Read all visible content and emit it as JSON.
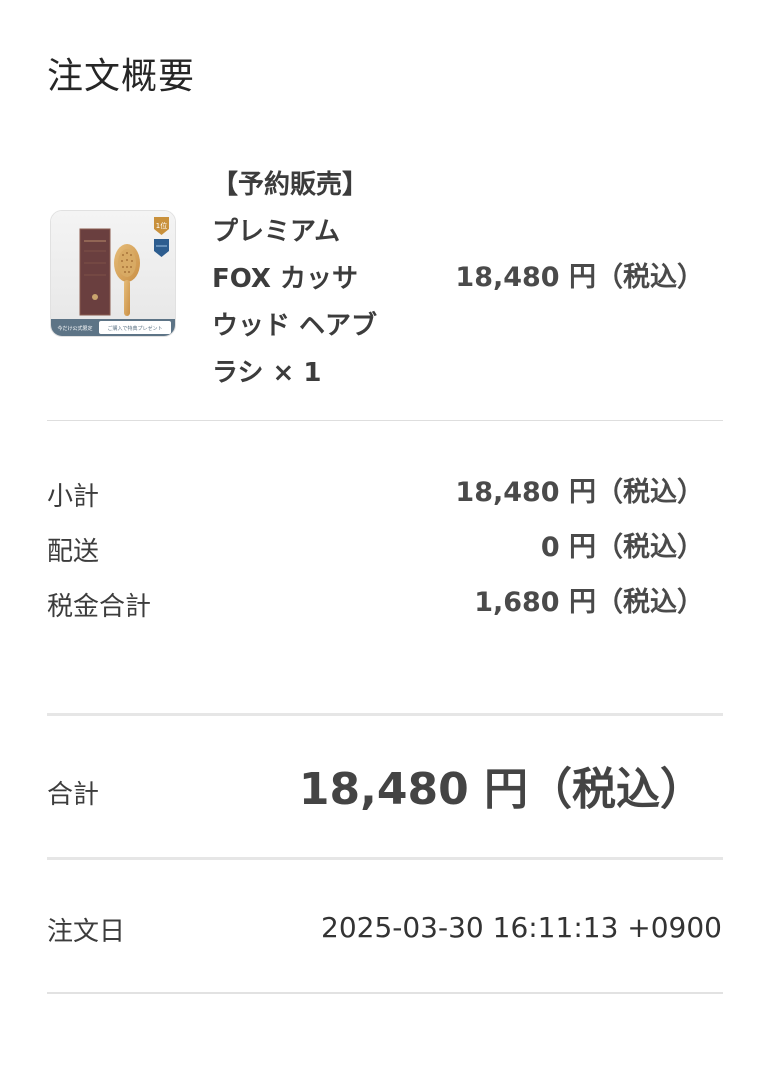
{
  "summary": {
    "title": "注文概要"
  },
  "product": {
    "name": "【予約販売】\nプレミアム\nFOX カッサ\nウッド ヘアブ\nラシ × 1",
    "price": "18,480 円（税込）",
    "thumb": {
      "icon": "hairbrush-product-image",
      "badge_top": "1位",
      "banner_left": "今だけ公式限定",
      "banner_right": "ご購入で特典プレゼント"
    }
  },
  "costs": {
    "subtotal": {
      "label": "小計",
      "value": "18,480 円（税込）"
    },
    "shipping": {
      "label": "配送",
      "value": "0 円（税込）"
    },
    "tax": {
      "label": "税金合計",
      "value": "1,680 円（税込）"
    }
  },
  "total": {
    "label": "合計",
    "value": "18,480 円（税込）"
  },
  "order_date": {
    "label": "注文日",
    "value": "2025-03-30 16:11:13 +0900"
  },
  "colors": {
    "text": "#303030",
    "divider": "#e2e2e2",
    "product_box": "#6a3f3f",
    "brush_wood": "#d9a75e",
    "badge_gold": "#c9913c",
    "badge_blue": "#2d5d8f"
  }
}
